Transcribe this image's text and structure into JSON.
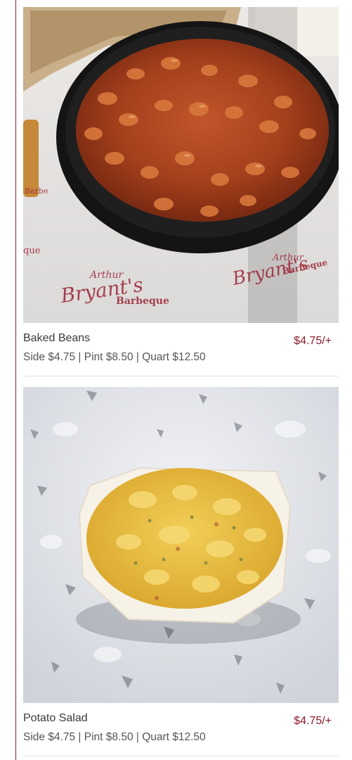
{
  "items": [
    {
      "name": "Baked Beans",
      "price": "$4.75/+",
      "sizes": "Side $4.75 | Pint $8.50 | Quart $12.50",
      "paper_brand": "Arthur Bryant's",
      "paper_sub": "Barbeque"
    },
    {
      "name": "Potato Salad",
      "price": "$4.75/+",
      "sizes": "Side $4.75 | Pint $8.50 | Quart $12.50"
    }
  ],
  "colors": {
    "accent": "#8a1c2b",
    "text": "#3a3a3a",
    "muted": "#555555",
    "divider": "#e3e3e3"
  }
}
